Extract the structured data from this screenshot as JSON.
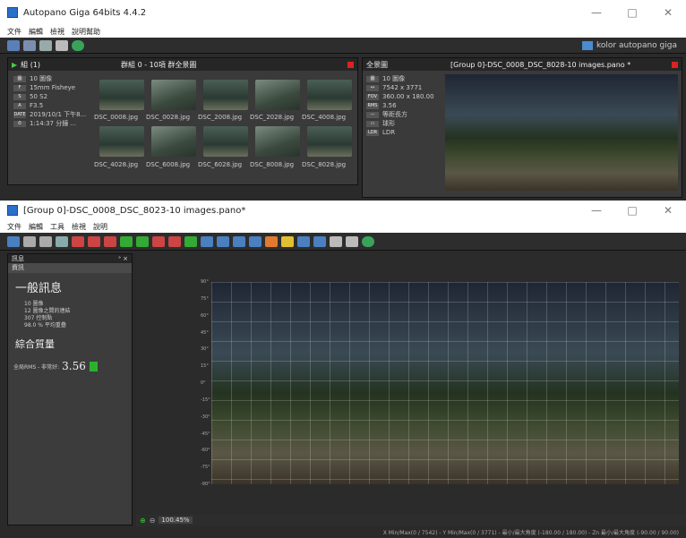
{
  "top": {
    "title": "Autopano Giga 64bits 4.4.2",
    "menu": [
      "文件",
      "編輯",
      "檢視",
      "說明幫助"
    ],
    "brand": "kolor autopano giga"
  },
  "left_panel": {
    "header": "組 (1)",
    "group_label": "群組 0 - 10項  群全景圖",
    "info": [
      {
        "tag": "圖",
        "text": "10 圖像"
      },
      {
        "tag": "F",
        "text": "15mm Fisheye"
      },
      {
        "tag": "S",
        "text": "50 S2"
      },
      {
        "tag": "A",
        "text": "F3.5"
      },
      {
        "tag": "DATE",
        "text": "2019/10/1 下午8..."
      },
      {
        "tag": "⏱",
        "text": "1:14:37 分鐘 ..."
      }
    ],
    "thumbs_row1": [
      "DSC_0008.jpg",
      "DSC_0028.jpg",
      "DSC_2008.jpg",
      "DSC_2028.jpg",
      "DSC_4008.jpg"
    ],
    "thumbs_row2": [
      "DSC_4028.jpg",
      "DSC_6008.jpg",
      "DSC_6028.jpg",
      "DSC_8008.jpg",
      "DSC_8028.jpg"
    ]
  },
  "right_panel": {
    "header": "全景圖",
    "file": "[Group 0]-DSC_0008_DSC_8028-10 images.pano *",
    "info": [
      {
        "tag": "圖",
        "text": "10 圖像"
      },
      {
        "tag": "↔",
        "text": "7542 x 3771"
      },
      {
        "tag": "FOV",
        "text": "360.00 x 180.00"
      },
      {
        "tag": "RMS",
        "text": "3.56"
      },
      {
        "tag": "—",
        "text": "等距長方"
      },
      {
        "tag": "▭",
        "text": "球形"
      },
      {
        "tag": "LDR",
        "text": "LDR"
      }
    ]
  },
  "editor": {
    "title": "[Group 0]-DSC_0008_DSC_8023-10 images.pano*",
    "menu": [
      "文件",
      "編輯",
      "工具",
      "檢視",
      "說明"
    ],
    "side_tab": "訊息",
    "side_sub": "資訊",
    "general_title": "一般訊息",
    "general_items": [
      "10 圖像",
      "12 圖像之間的連結",
      "307 控制點",
      "98.0 % 平均重疊"
    ],
    "quality_title": "綜合質量",
    "quality_label": "全局RMS - 非常好:",
    "quality_value": "3.56",
    "zoom": "100.45%",
    "status": "X Min/Max(0 / 7542) - Y Min/Max(0 / 3771) - 最小/最大角度 (-180.00 / 180.00) - Zn 最小/最大角度 (-90.00 / 90.00)"
  },
  "y_labels": [
    "90°",
    "75°",
    "60°",
    "45°",
    "30°",
    "15°",
    "0°",
    "-15°",
    "-30°",
    "-45°",
    "-60°",
    "-75°",
    "-90°"
  ]
}
